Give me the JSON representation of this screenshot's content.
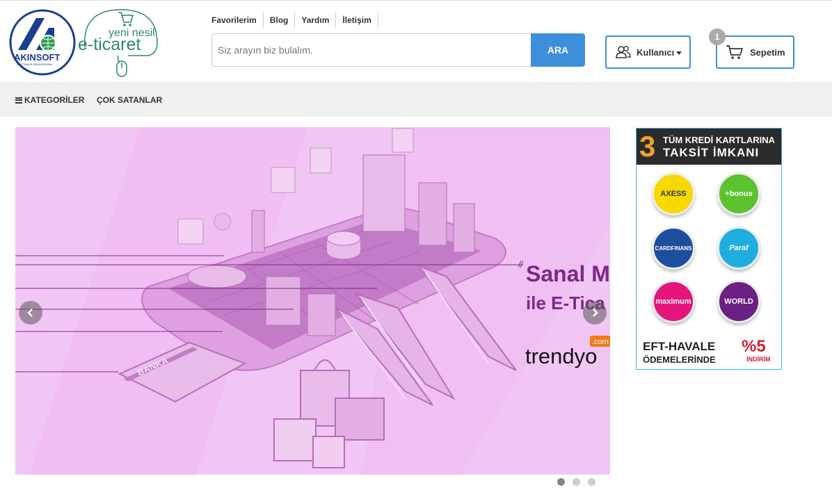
{
  "header": {
    "logo_text": "AKINSOFT",
    "logo_sub": "SOFTWARE ENGINEERING",
    "eticaret_top": "yeni nesil",
    "eticaret_main": "e-ticaret",
    "top_links": [
      "Favorilerim",
      "Blog",
      "Yardım",
      "İletişim"
    ],
    "search": {
      "placeholder": "Siz arayın biz bulalım.",
      "value": "",
      "button_label": "ARA"
    },
    "user_label": "Kullanıcı",
    "cart_label": "Sepetim",
    "cart_count": "1"
  },
  "nav": {
    "categories_label": "KATEGORİLER",
    "bestsellers_label": "ÇOK SATANLAR"
  },
  "slider": {
    "headline_1": "Sanal M",
    "headline_2": "ile E-Tica",
    "brand": "trendyo",
    "brand_badge": ".com",
    "card_text": "BANKA",
    "slide_count": 3,
    "active_slide": 1
  },
  "promo": {
    "number": "3",
    "line1": "TÜM KREDİ KARTLARINA",
    "line2": "TAKSİT İMKANI",
    "cards": [
      {
        "name": "AXESS",
        "color": "#f5d900",
        "text_color": "#333"
      },
      {
        "name": "+bonus",
        "color": "#5cc22e",
        "text_color": "#fff"
      },
      {
        "name": "CARDFINANS",
        "color": "#1c4e9e",
        "text_color": "#fff"
      },
      {
        "name": "Paraf",
        "color": "#1eaee0",
        "text_color": "#fff"
      },
      {
        "name": "maximum",
        "color": "#e6157d",
        "text_color": "#fff"
      },
      {
        "name": "WORLD",
        "color": "#6a2183",
        "text_color": "#fff"
      }
    ],
    "footer_line1": "EFT-HAVALE",
    "footer_line2": "ÖDEMELERİNDE",
    "discount": "%5",
    "discount_label": "İNDİRİM"
  },
  "colors": {
    "accent": "#3d8fdc",
    "slider_bg": "#f2c6f4",
    "slider_shape": "#d692d6",
    "headline": "#7a2a86",
    "nav_bg": "#f0f0f0"
  }
}
